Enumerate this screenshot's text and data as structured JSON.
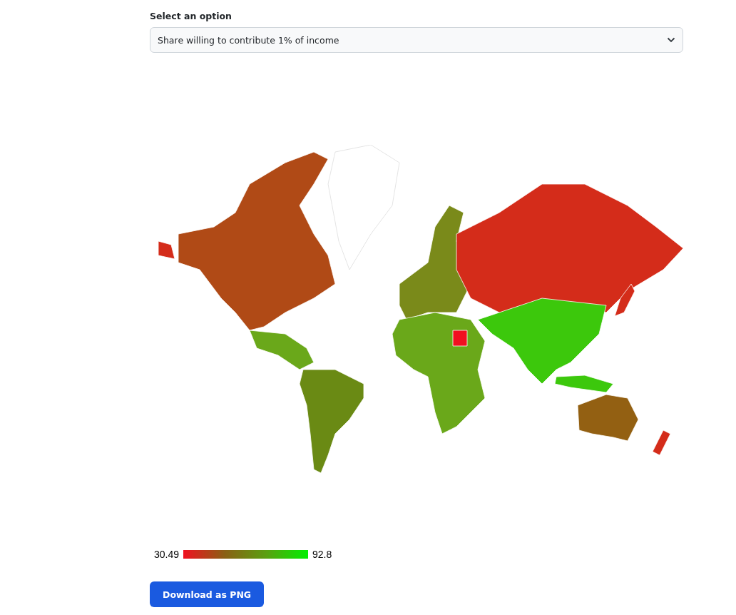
{
  "select": {
    "label": "Select an option",
    "value": "Share willing to contribute 1% of income"
  },
  "legend": {
    "min": "30.49",
    "max": "92.8"
  },
  "download_button": {
    "label": "Download as PNG"
  }
}
